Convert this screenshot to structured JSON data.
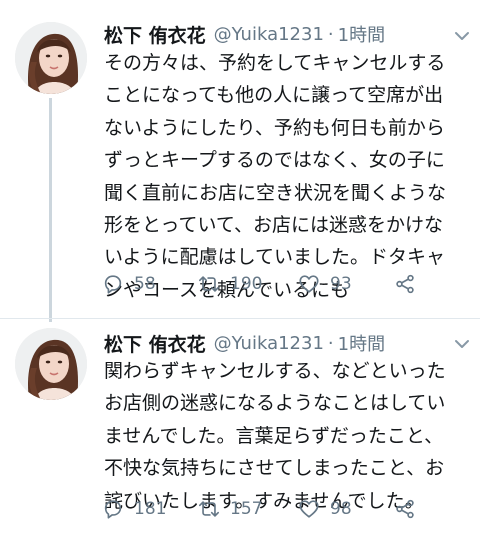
{
  "tweets": [
    {
      "display_name": "松下 侑衣花",
      "handle": "@Yuika1231",
      "separator": "·",
      "time": "1時間",
      "lines": [
        "その方々は、予約をしてキャンセルする",
        "ことになっても他の人に譲って空席が出",
        "ないようにしたり、予約も何日も前から",
        "ずっとキープするのではなく、女の子に",
        "聞く直前にお店に空き状況を聞くような",
        "形をとっていて、お店には迷惑をかけな",
        "いように配慮はしていました。ドタキャ",
        "ンやコースを頼んでいるにも"
      ],
      "replies": "58",
      "retweets": "190",
      "likes": "93"
    },
    {
      "display_name": "松下 侑衣花",
      "handle": "@Yuika1231",
      "separator": "·",
      "time": "1時間",
      "lines": [
        "関わらずキャンセルする、などといった",
        "お店側の迷惑になるようなことはしてい",
        "ませんでした。言葉足らずだったこと、",
        "不快な気持ちにさせてしまったこと、お",
        "詫びいたします。すみませんでした。"
      ],
      "replies": "181",
      "retweets": "157",
      "likes": "98"
    }
  ],
  "icons": {
    "reply": "reply-icon",
    "retweet": "retweet-icon",
    "like": "heart-icon",
    "share": "share-icon",
    "caret": "chevron-down-icon"
  },
  "colors": {
    "text": "#14171a",
    "secondary": "#657786",
    "thread_line": "#ccd6dd",
    "divider": "#e1e8ed"
  }
}
